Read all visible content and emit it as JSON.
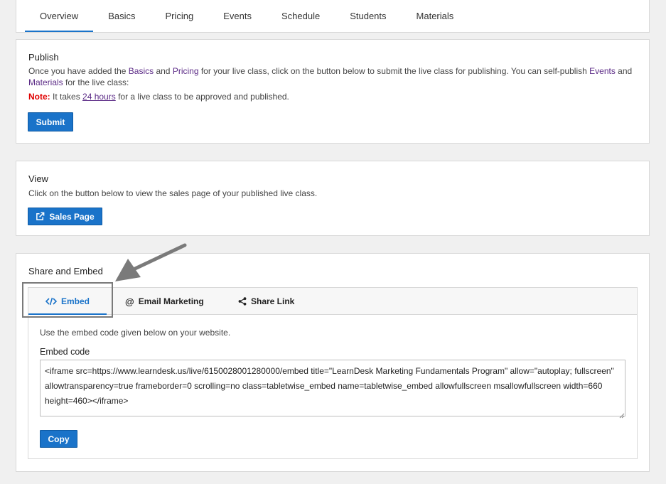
{
  "tabs": [
    {
      "label": "Overview",
      "active": true
    },
    {
      "label": "Basics"
    },
    {
      "label": "Pricing"
    },
    {
      "label": "Events"
    },
    {
      "label": "Schedule"
    },
    {
      "label": "Students"
    },
    {
      "label": "Materials"
    }
  ],
  "publish": {
    "title": "Publish",
    "text_1": "Once you have added the ",
    "link_basics": "Basics",
    "text_2": " and ",
    "link_pricing": "Pricing",
    "text_3": " for your live class, click on the button below to submit the live class for publishing. You can self-publish ",
    "link_events": "Events",
    "text_4": " and",
    "link_materials": "Materials",
    "text_5": " for the live class:",
    "note_label": "Note:",
    "note_text_1": " It takes ",
    "note_link": "24 hours",
    "note_text_2": " for a live class to be approved and published.",
    "submit_label": "Submit"
  },
  "view": {
    "title": "View",
    "text": "Click on the button below to view the sales page of your published live class.",
    "sales_page_label": "Sales Page"
  },
  "share": {
    "title": "Share and Embed",
    "tabs": [
      {
        "label": "Embed",
        "icon": "code-icon",
        "active": true
      },
      {
        "label": "Email Marketing",
        "icon": "at-icon"
      },
      {
        "label": "Share Link",
        "icon": "share-icon"
      }
    ],
    "instruction": "Use the embed code given below on your website.",
    "embed_code_label": "Embed code",
    "embed_code": "<iframe src=https://www.learndesk.us/live/6150028001280000/embed title=\"LearnDesk Marketing Fundamentals Program\" allow=\"autoplay; fullscreen\" allowtransparency=true frameborder=0 scrolling=no class=tabletwise_embed name=tabletwise_embed allowfullscreen msallowfullscreen width=660 height=460></iframe>",
    "copy_label": "Copy"
  },
  "colors": {
    "accent": "#1a73c9",
    "link": "#5b2a86",
    "note": "#e00000"
  }
}
